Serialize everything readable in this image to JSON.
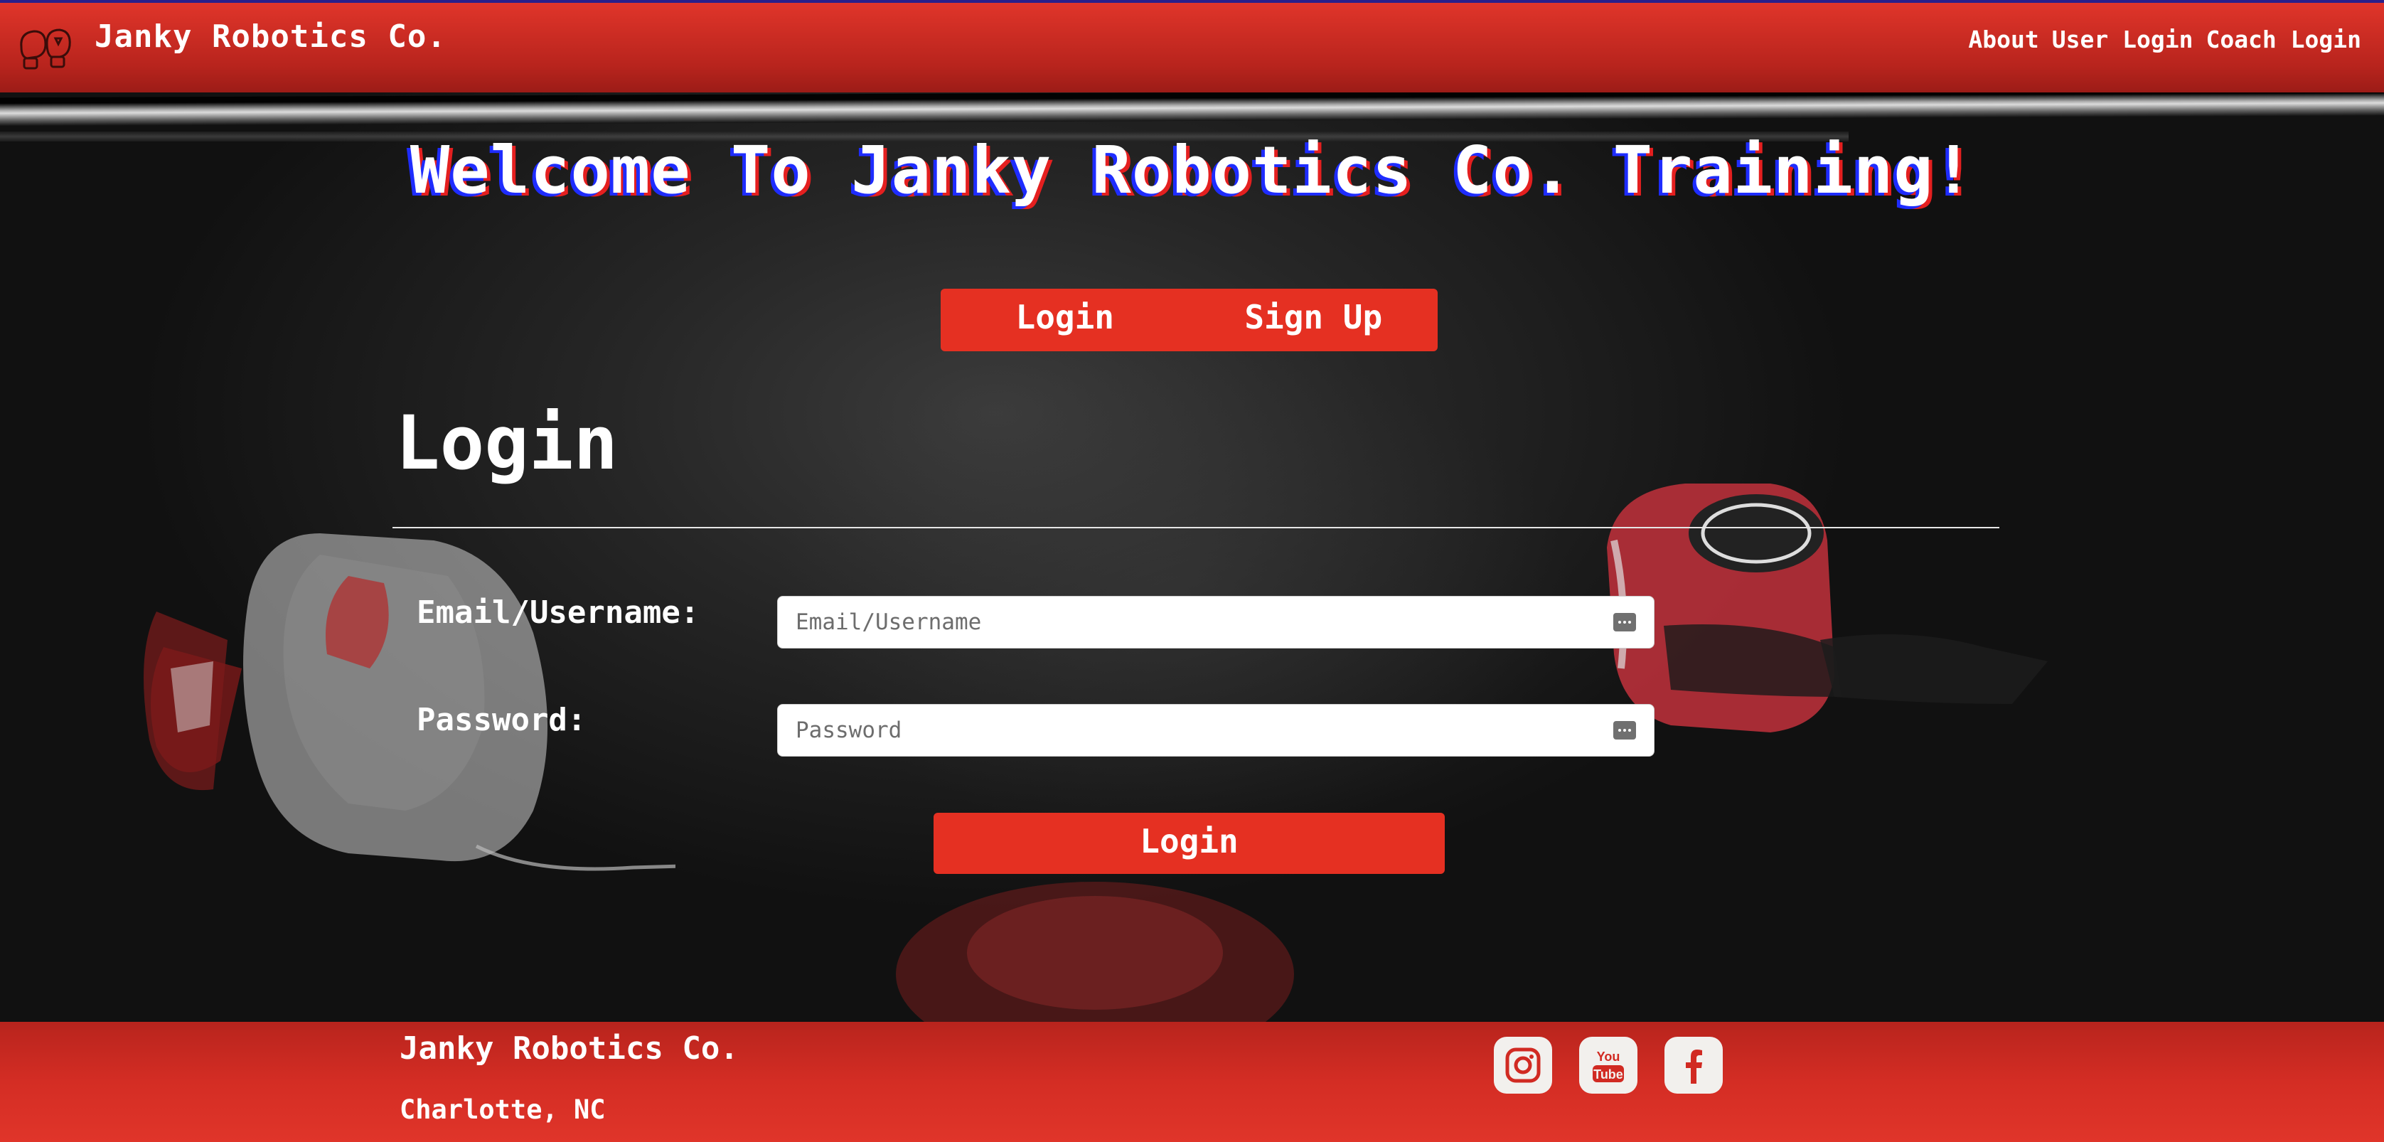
{
  "navbar": {
    "brand": "Janky Robotics Co.",
    "links": [
      "About",
      "User Login",
      "Coach Login"
    ]
  },
  "hero": {
    "welcome": "Welcome To Janky Robotics Co. Training!"
  },
  "toggle": {
    "login_label": "Login",
    "signup_label": "Sign Up"
  },
  "form": {
    "title": "Login",
    "email_label": "Email/Username:",
    "email_placeholder": "Email/Username",
    "password_label": "Password:",
    "password_placeholder": "Password",
    "submit_label": "Login"
  },
  "footer": {
    "brand": "Janky Robotics Co.",
    "location": "Charlotte, NC",
    "socials": [
      "instagram-icon",
      "youtube-icon",
      "facebook-icon"
    ]
  },
  "colors": {
    "accent": "#e53022",
    "nav_top": "#e0352a",
    "nav_bottom": "#9c1c17",
    "title_shadow_blue": "#1e2cff",
    "title_shadow_red": "#e41f1f"
  }
}
